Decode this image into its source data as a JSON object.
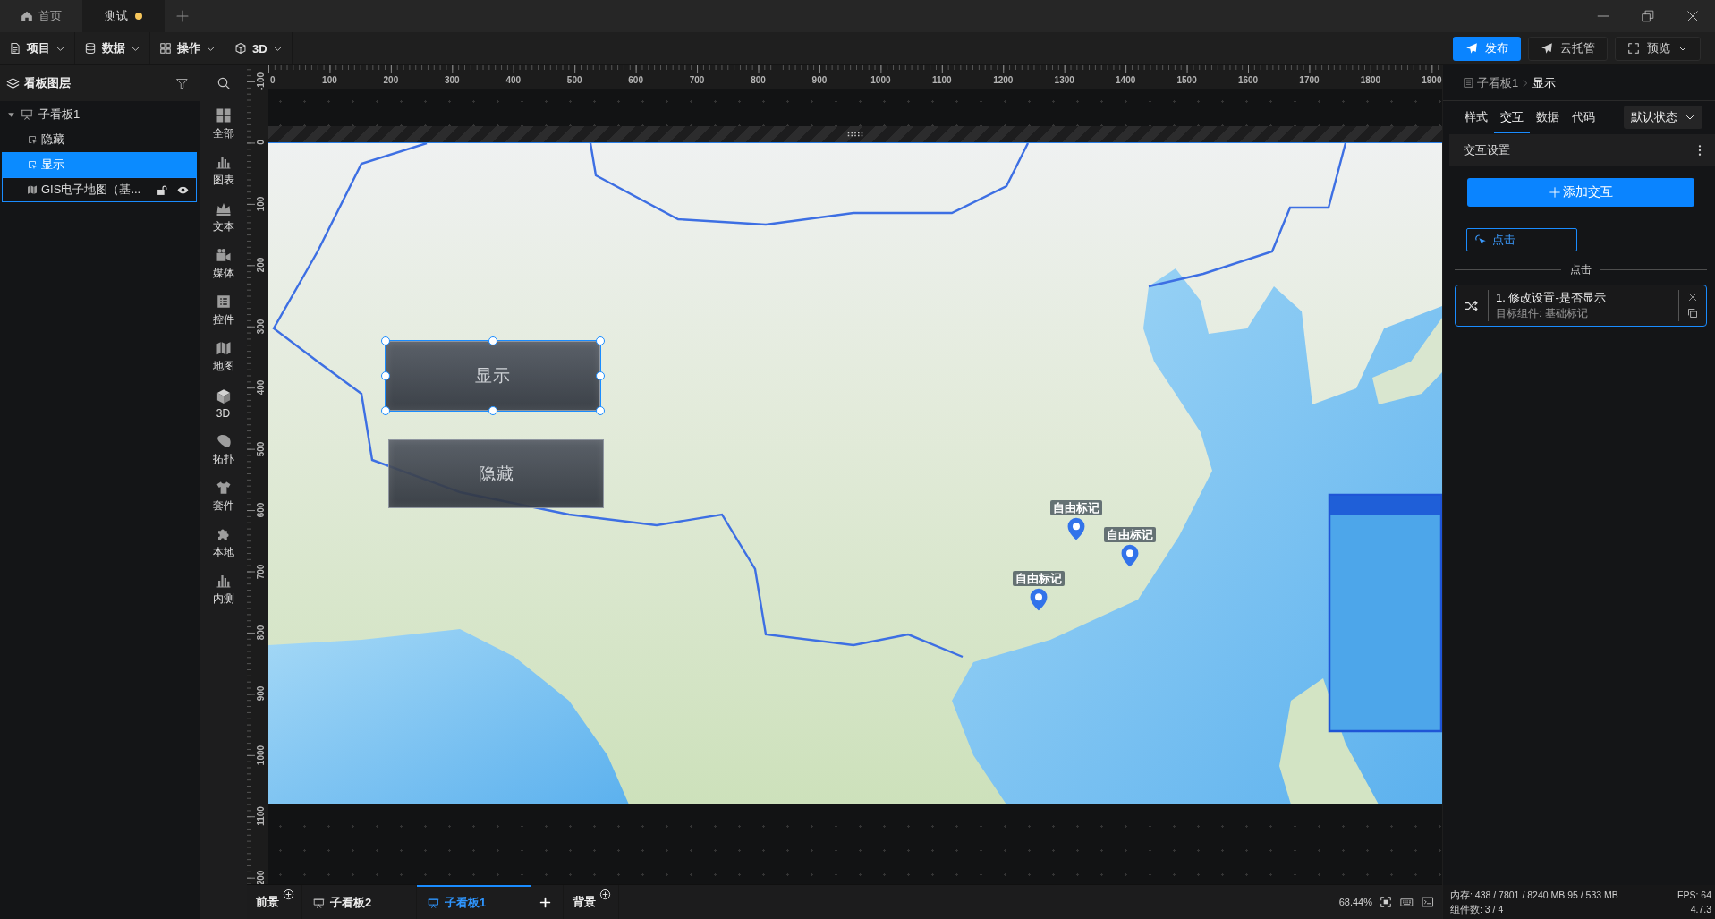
{
  "tabs": [
    {
      "label": "首页",
      "kind": "home",
      "selected": false,
      "modified": false
    },
    {
      "label": "测试",
      "kind": "page",
      "selected": true,
      "modified": true
    }
  ],
  "menus": [
    {
      "label": "项目",
      "kind": "file"
    },
    {
      "label": "数据",
      "kind": "database"
    },
    {
      "label": "操作",
      "kind": "grid"
    },
    {
      "label": "3D",
      "kind": "cube"
    }
  ],
  "actions": [
    {
      "label": "发布",
      "kind": "publish"
    },
    {
      "label": "云托管",
      "kind": "host"
    },
    {
      "label": "预览",
      "kind": "preview"
    }
  ],
  "layers": {
    "title": "看板图层",
    "items": [
      {
        "label": "子看板1",
        "kind": "board",
        "expanded": true,
        "children": [
          {
            "label": "隐藏",
            "kind": "button",
            "selected": false,
            "hovered": false
          },
          {
            "label": "显示",
            "kind": "button",
            "selected": true,
            "hovered": false
          },
          {
            "label": "GIS电子地图（基...",
            "kind": "map",
            "selected": false,
            "hovered": true
          }
        ]
      }
    ]
  },
  "components": [
    {
      "label": "全部",
      "kind": "all"
    },
    {
      "label": "图表",
      "kind": "chart"
    },
    {
      "label": "文本",
      "kind": "text"
    },
    {
      "label": "媒体",
      "kind": "media"
    },
    {
      "label": "控件",
      "kind": "control"
    },
    {
      "label": "地图",
      "kind": "map"
    },
    {
      "label": "3D",
      "kind": "cube"
    },
    {
      "label": "拓扑",
      "kind": "topology"
    },
    {
      "label": "套件",
      "kind": "suite"
    },
    {
      "label": "本地",
      "kind": "local"
    },
    {
      "label": "内测",
      "kind": "beta"
    }
  ],
  "ruler": {
    "x_labels": [
      "0",
      "100",
      "200",
      "300",
      "400",
      "500",
      "600",
      "700",
      "800",
      "900",
      "1000",
      "1100",
      "1200",
      "1300",
      "1400",
      "1500",
      "1600",
      "1700",
      "1800",
      "1900"
    ],
    "y_labels": [
      "-100",
      "0",
      "100",
      "200",
      "300",
      "400",
      "500",
      "600",
      "700",
      "800",
      "900",
      "1000",
      "1100",
      "200"
    ]
  },
  "board": {
    "widgets": [
      {
        "label": "显示",
        "selected": true
      },
      {
        "label": "隐藏",
        "selected": false
      }
    ],
    "markers": [
      {
        "label": "自由标记"
      },
      {
        "label": "自由标记"
      },
      {
        "label": "自由标记"
      }
    ]
  },
  "scenes": {
    "foreground": "前景",
    "boards": [
      {
        "label": "子看板2",
        "selected": false
      },
      {
        "label": "子看板1",
        "selected": true
      }
    ],
    "background": "背景",
    "zoom": "68.44%"
  },
  "inspector": {
    "breadcrumb": [
      "子看板1",
      "显示"
    ],
    "tabs": [
      {
        "label": "样式",
        "selected": false
      },
      {
        "label": "交互",
        "selected": true
      },
      {
        "label": "数据",
        "selected": false
      },
      {
        "label": "代码",
        "selected": false
      }
    ],
    "state": "默认状态",
    "section": "交互设置",
    "add_label": "添加交互",
    "triggers": [
      {
        "label": "点击",
        "selected": true
      }
    ],
    "groups": [
      {
        "title": "点击",
        "actions": [
          {
            "title": "1. 修改设置-是否显示",
            "target": "目标组件: 基础标记"
          }
        ]
      }
    ]
  },
  "status": {
    "memory": "内存: 438 / 7801 / 8240 MB 95 / 533 MB",
    "fps": "FPS: 64",
    "components": "组件数: 3 / 4",
    "version": "4.7.3"
  }
}
